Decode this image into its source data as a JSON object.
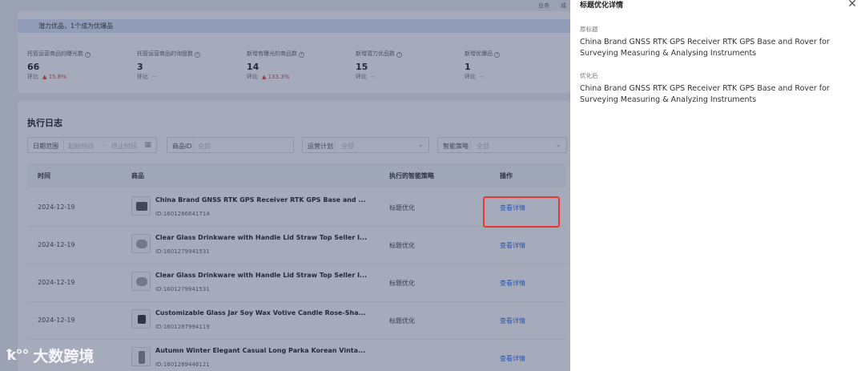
{
  "topnav": {
    "item1": "业务",
    "item2": "成"
  },
  "potential_text": "潜力优品，1个成为优爆品",
  "stats": [
    {
      "label": "托管运营商品的曝光数",
      "value": "66",
      "cmp_label": "环比",
      "change": "▲ 15.8%"
    },
    {
      "label": "托管运营商品的询盘数",
      "value": "3",
      "cmp_label": "环比",
      "change": "--"
    },
    {
      "label": "新增有曝光的商品数",
      "value": "14",
      "cmp_label": "环比",
      "change": "▲ 133.3%"
    },
    {
      "label": "新增潜力优品数",
      "value": "15",
      "cmp_label": "环比",
      "change": "--"
    },
    {
      "label": "新增优爆品",
      "value": "1",
      "cmp_label": "环比",
      "change": "--"
    }
  ],
  "log": {
    "title": "执行日志",
    "filters": {
      "date_label": "日期范围",
      "date_start": "起始时间",
      "date_end": "终止时间",
      "product_id_label": "商品ID",
      "product_id_value": "全部",
      "plan_label": "运营计划",
      "plan_value": "全部",
      "strategy_label": "智能策略",
      "strategy_value": "全部"
    },
    "columns": {
      "time": "时间",
      "product": "商品",
      "strategy": "执行的智能策略",
      "action": "操作"
    },
    "rows": [
      {
        "date": "2024-12-19",
        "name": "China Brand GNSS RTK GPS Receiver RTK GPS Base and ...",
        "id": "ID:1601286641714",
        "strategy": "标题优化",
        "action": "查看详情"
      },
      {
        "date": "2024-12-19",
        "name": "Clear Glass Drinkware with Handle Lid Straw Top Seller I...",
        "id": "ID:1601279941531",
        "strategy": "标题优化",
        "action": "查看详情"
      },
      {
        "date": "2024-12-19",
        "name": "Clear Glass Drinkware with Handle Lid Straw Top Seller I...",
        "id": "ID:1601279941531",
        "strategy": "标题优化",
        "action": "查看详情"
      },
      {
        "date": "2024-12-19",
        "name": "Customizable Glass Jar Soy Wax Votive Candle Rose-Sha...",
        "id": "ID:1601287994119",
        "strategy": "标题优化",
        "action": "查看详情"
      },
      {
        "date": "",
        "name": "Autumn Winter Elegant Casual Long Parka Korean Vinta...",
        "id": "ID:1601289448121",
        "strategy": "",
        "action": "查看详情"
      }
    ]
  },
  "panel": {
    "title": "标题优化详情",
    "original_label": "原标题",
    "original_value": "China Brand GNSS RTK GPS Receiver RTK GPS Base and Rover for Surveying Measuring & Analysing Instruments",
    "optimized_label": "优化后",
    "optimized_value": "China Brand GNSS RTK GPS Receiver RTK GPS Base and Rover for Surveying Measuring & Analyzing Instruments"
  },
  "watermark": {
    "logo": "₀₀",
    "text": "大数跨境"
  },
  "colors": {
    "accent": "#2a6ff0",
    "up": "#e0403a",
    "annotation": "#e8382f"
  }
}
